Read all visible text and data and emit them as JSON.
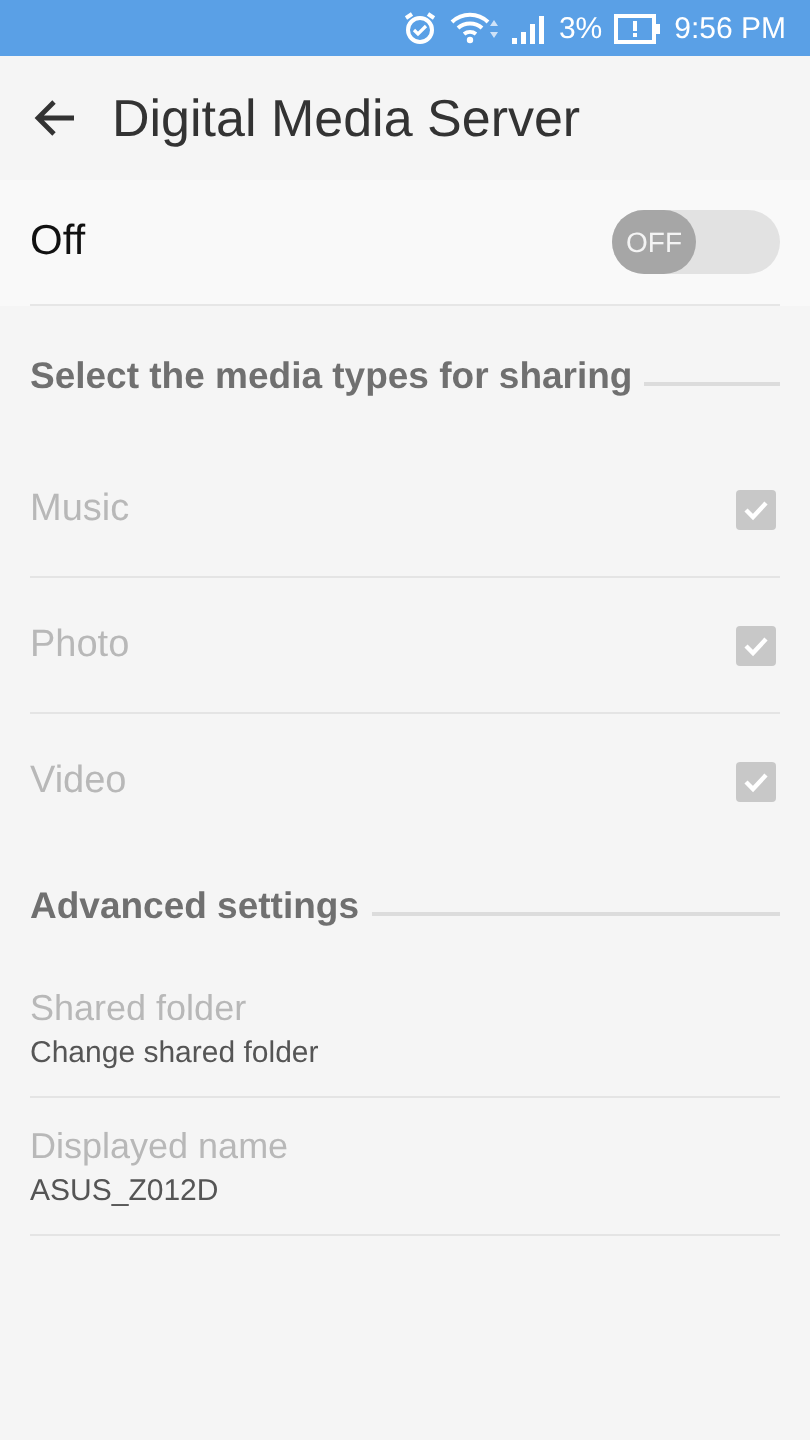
{
  "status_bar": {
    "battery": "3%",
    "time": "9:56 PM"
  },
  "app_bar": {
    "title": "Digital Media Server"
  },
  "master_switch": {
    "label": "Off",
    "switch_text": "OFF",
    "on": false
  },
  "media_section": {
    "title": "Select the media types for sharing",
    "items": [
      {
        "label": "Music",
        "checked": true,
        "disabled": true
      },
      {
        "label": "Photo",
        "checked": true,
        "disabled": true
      },
      {
        "label": "Video",
        "checked": true,
        "disabled": true
      }
    ]
  },
  "advanced_section": {
    "title": "Advanced settings",
    "items": [
      {
        "title": "Shared folder",
        "summary": "Change shared folder",
        "disabled": true
      },
      {
        "title": "Displayed name",
        "summary": "ASUS_Z012D",
        "disabled": true
      }
    ]
  }
}
